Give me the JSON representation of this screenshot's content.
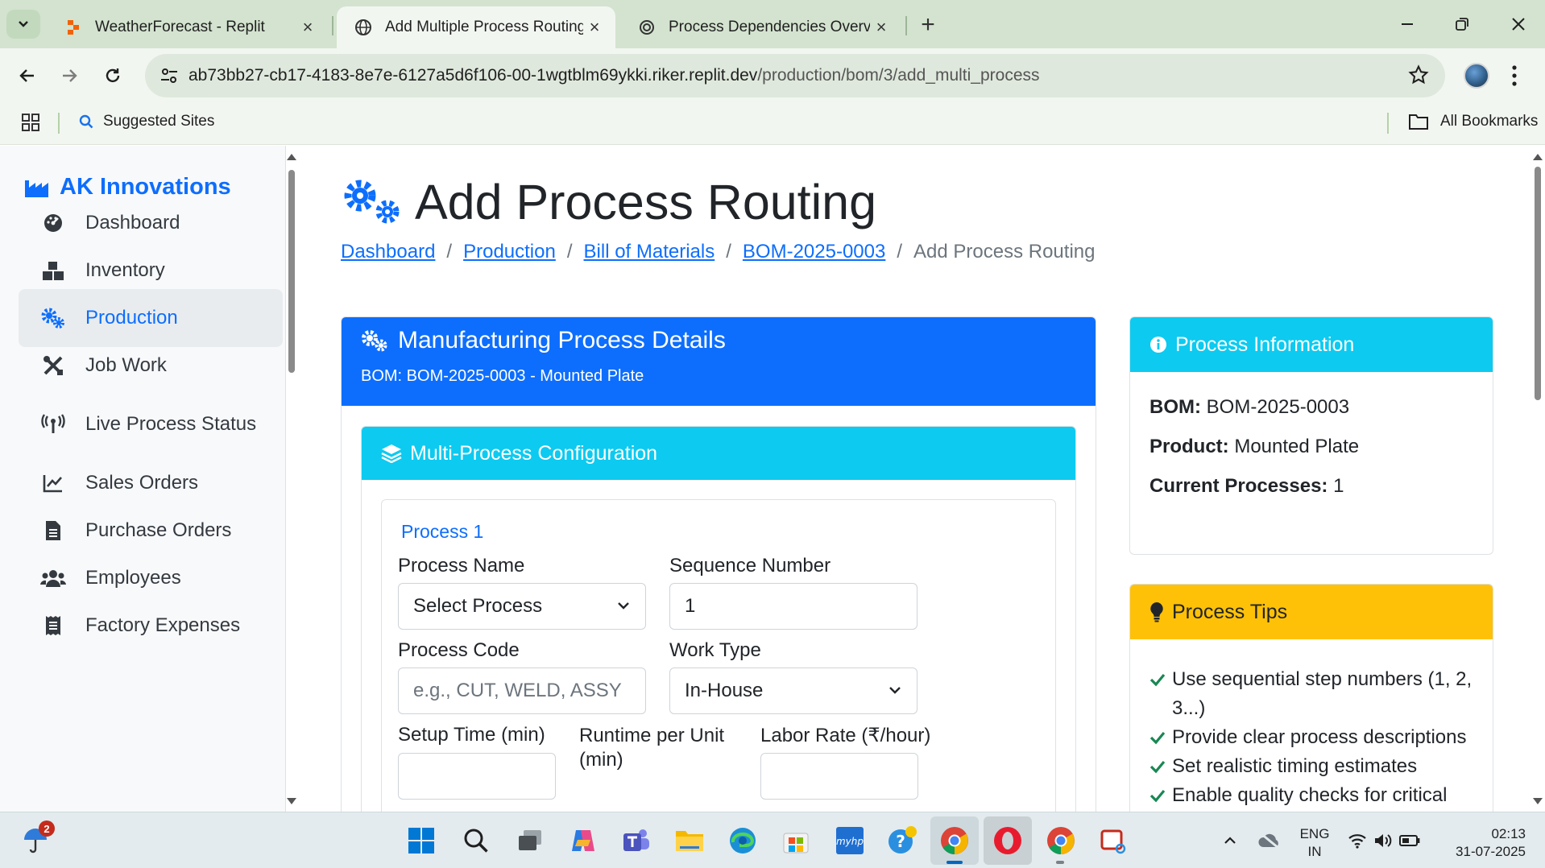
{
  "browser": {
    "tabs": [
      {
        "title": "WeatherForecast - Replit",
        "icon": "replit-icon"
      },
      {
        "title": "Add Multiple Process Routing -",
        "icon": "globe-icon"
      },
      {
        "title": "Process Dependencies Overview",
        "icon": "openai-icon"
      }
    ],
    "url_domain": "ab73bb27-cb17-4183-8e7e-6127a5d6f106-00-1wgtblm69ykki.riker.replit.dev",
    "url_path": "/production/bom/3/add_multi_process",
    "bookmarks": {
      "suggested": "Suggested Sites",
      "all": "All Bookmarks"
    }
  },
  "sidebar": {
    "brand": "AK Innovations",
    "items": [
      {
        "label": "Dashboard",
        "icon": "dashboard-icon"
      },
      {
        "label": "Inventory",
        "icon": "boxes-icon"
      },
      {
        "label": "Production",
        "icon": "gears-icon",
        "active": true
      },
      {
        "label": "Job Work",
        "icon": "tools-icon"
      },
      {
        "label": "Live Process Status",
        "icon": "broadcast-icon"
      },
      {
        "label": "Sales Orders",
        "icon": "line-chart-icon"
      },
      {
        "label": "Purchase Orders",
        "icon": "invoice-icon"
      },
      {
        "label": "Employees",
        "icon": "users-icon"
      },
      {
        "label": "Factory Expenses",
        "icon": "receipt-icon"
      }
    ]
  },
  "page": {
    "title": "Add Process Routing",
    "breadcrumb": [
      "Dashboard",
      "Production",
      "Bill of Materials",
      "BOM-2025-0003",
      "Add Process Routing"
    ]
  },
  "details_card": {
    "title": "Manufacturing Process Details",
    "subtitle": "BOM: BOM-2025-0003 - Mounted Plate",
    "config_title": "Multi-Process Configuration",
    "process": {
      "title": "Process 1",
      "process_name_label": "Process Name",
      "process_name_value": "Select Process",
      "sequence_label": "Sequence Number",
      "sequence_value": "1",
      "code_label": "Process Code",
      "code_placeholder": "e.g., CUT, WELD, ASSY",
      "work_type_label": "Work Type",
      "work_type_value": "In-House",
      "setup_label": "Setup Time (min)",
      "runtime_label": "Runtime per Unit (min)",
      "labor_label": "Labor Rate (₹/hour)"
    }
  },
  "info_card": {
    "title": "Process Information",
    "bom_label": "BOM:",
    "bom_value": "BOM-2025-0003",
    "product_label": "Product:",
    "product_value": "Mounted Plate",
    "current_label": "Current Processes:",
    "current_value": "1"
  },
  "tips_card": {
    "title": "Process Tips",
    "tips": [
      "Use sequential step numbers (1, 2, 3...)",
      "Provide clear process descriptions",
      "Set realistic timing estimates",
      "Enable quality checks for critical"
    ]
  },
  "taskbar": {
    "weather_badge": "2",
    "lang": "ENG",
    "region": "IN",
    "time": "02:13",
    "date": "31-07-2025"
  },
  "colors": {
    "primary": "#0d6efd",
    "info": "#0dcaf0",
    "warning": "#ffc107",
    "chrome_frame": "#d3e3cf"
  }
}
